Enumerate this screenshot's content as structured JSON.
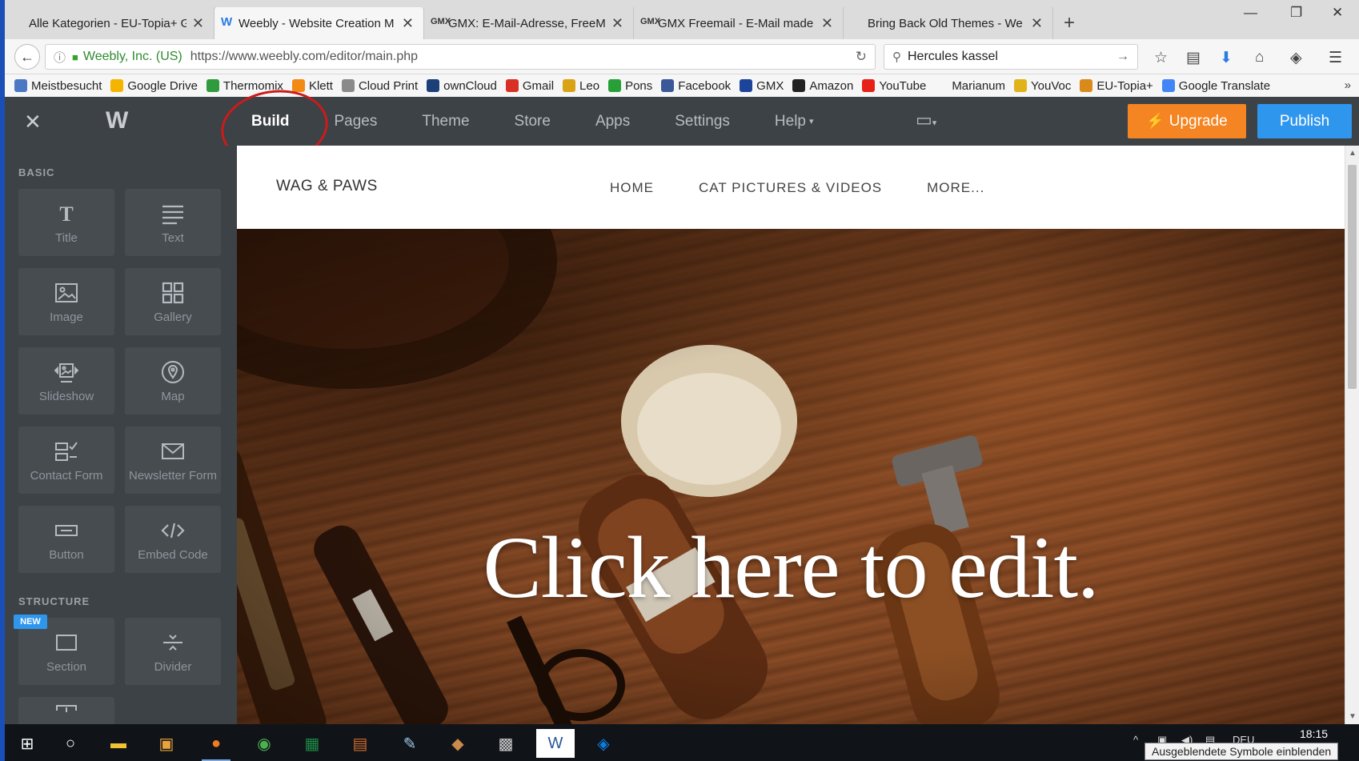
{
  "browser": {
    "tabs": [
      {
        "icon": "",
        "title": "Alle Kategorien - EU-Topia+ Ger",
        "active": false
      },
      {
        "icon": "W",
        "title": "Weebly - Website Creation M",
        "active": true
      },
      {
        "icon": "GMX",
        "title": "GMX: E-Mail-Adresse, FreeM",
        "active": false
      },
      {
        "icon": "GMX",
        "title": "GMX Freemail - E-Mail made",
        "active": false
      },
      {
        "icon": "",
        "title": "Bring Back Old Themes - We",
        "active": false
      }
    ],
    "site_identity": "Weebly, Inc. (US)",
    "url": "https://www.weebly.com/editor/main.php",
    "search_value": "Hercules kassel",
    "bookmarks": [
      {
        "label": "Meistbesucht",
        "color": "#4a78c2"
      },
      {
        "label": "Google Drive",
        "color": "#f4b400"
      },
      {
        "label": "Thermomix",
        "color": "#2f9b3c"
      },
      {
        "label": "Klett",
        "color": "#f18b16"
      },
      {
        "label": "Cloud Print",
        "color": "#8a8a8a"
      },
      {
        "label": "ownCloud",
        "color": "#1c3f78"
      },
      {
        "label": "Gmail",
        "color": "#d93025"
      },
      {
        "label": "Leo",
        "color": "#d9a316"
      },
      {
        "label": "Pons",
        "color": "#27a137"
      },
      {
        "label": "Facebook",
        "color": "#3b5998"
      },
      {
        "label": "GMX",
        "color": "#1c449b"
      },
      {
        "label": "Amazon",
        "color": "#222222"
      },
      {
        "label": "YouTube",
        "color": "#e62117"
      },
      {
        "label": "Marianum",
        "color": "#f6f6f6"
      },
      {
        "label": "YouVoc",
        "color": "#e0b31a"
      },
      {
        "label": "EU-Topia+",
        "color": "#d98a1a"
      },
      {
        "label": "Google Translate",
        "color": "#4285f4"
      }
    ]
  },
  "editor": {
    "nav": [
      {
        "label": "Build",
        "active": true
      },
      {
        "label": "Pages",
        "active": false
      },
      {
        "label": "Theme",
        "active": false
      },
      {
        "label": "Store",
        "active": false
      },
      {
        "label": "Apps",
        "active": false
      },
      {
        "label": "Settings",
        "active": false
      },
      {
        "label": "Help",
        "active": false
      }
    ],
    "upgrade_label": "Upgrade",
    "publish_label": "Publish",
    "colors": {
      "upgrade": "#f48522",
      "publish": "#2f96ee",
      "bar": "#3d4246",
      "annotation": "#cc1b1b"
    }
  },
  "sidebar": {
    "basic_heading": "BASIC",
    "structure_heading": "STRUCTURE",
    "new_badge": "NEW",
    "tiles": [
      {
        "icon": "title-icon",
        "label": "Title"
      },
      {
        "icon": "text-icon",
        "label": "Text"
      },
      {
        "icon": "image-icon",
        "label": "Image"
      },
      {
        "icon": "gallery-icon",
        "label": "Gallery"
      },
      {
        "icon": "slideshow-icon",
        "label": "Slideshow"
      },
      {
        "icon": "map-icon",
        "label": "Map"
      },
      {
        "icon": "contact-form-icon",
        "label": "Contact Form"
      },
      {
        "icon": "newsletter-form-icon",
        "label": "Newsletter Form"
      },
      {
        "icon": "button-icon",
        "label": "Button"
      },
      {
        "icon": "embed-code-icon",
        "label": "Embed Code"
      },
      {
        "icon": "section-icon",
        "label": "Section"
      },
      {
        "icon": "divider-icon",
        "label": "Divider"
      }
    ]
  },
  "site": {
    "title": "WAG & PAWS",
    "nav": [
      "HOME",
      "CAT PICTURES & VIDEOS",
      "MORE..."
    ],
    "hero_text": "Click here to edit."
  },
  "taskbar": {
    "clock": "18:15",
    "language": "DEU",
    "tooltip": "Ausgeblendete Symbole einblenden"
  }
}
